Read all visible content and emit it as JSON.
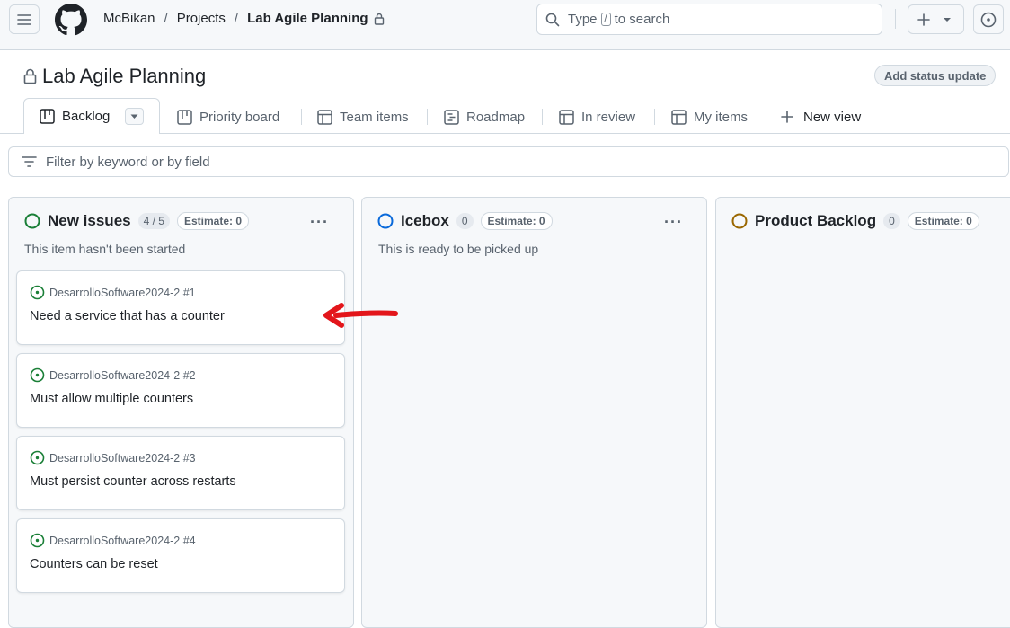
{
  "header": {
    "breadcrumbs": [
      "McBikan",
      "Projects",
      "Lab Agile Planning"
    ],
    "search": {
      "prefix": "Type",
      "key": "/",
      "suffix": "to search"
    }
  },
  "project": {
    "title": "Lab Agile Planning",
    "status_button": "Add status update"
  },
  "tabs": [
    {
      "label": "Backlog",
      "icon": "board-icon",
      "active": true
    },
    {
      "label": "Priority board",
      "icon": "board-icon"
    },
    {
      "label": "Team items",
      "icon": "table-icon"
    },
    {
      "label": "Roadmap",
      "icon": "roadmap-icon"
    },
    {
      "label": "In review",
      "icon": "table-icon"
    },
    {
      "label": "My items",
      "icon": "table-icon"
    },
    {
      "label": "New view",
      "icon": "plus-icon"
    }
  ],
  "filter": {
    "placeholder": "Filter by keyword or by field"
  },
  "columns": [
    {
      "name": "New issues",
      "count": "4 / 5",
      "estimate": "Estimate: 0",
      "description": "This item hasn't been started",
      "color": "#1a7f37",
      "cards": [
        {
          "repo": "DesarrolloSoftware2024-2 #1",
          "title": "Need a service that has a counter"
        },
        {
          "repo": "DesarrolloSoftware2024-2 #2",
          "title": "Must allow multiple counters"
        },
        {
          "repo": "DesarrolloSoftware2024-2 #3",
          "title": "Must persist counter across restarts"
        },
        {
          "repo": "DesarrolloSoftware2024-2 #4",
          "title": "Counters can be reset"
        }
      ]
    },
    {
      "name": "Icebox",
      "count": "0",
      "estimate": "Estimate: 0",
      "description": "This is ready to be picked up",
      "color": "#0969da",
      "cards": []
    },
    {
      "name": "Product Backlog",
      "count": "0",
      "estimate": "Estimate: 0",
      "description": "",
      "color": "#9a6700",
      "cards": []
    }
  ],
  "annotation": {
    "color": "#e3161b"
  }
}
